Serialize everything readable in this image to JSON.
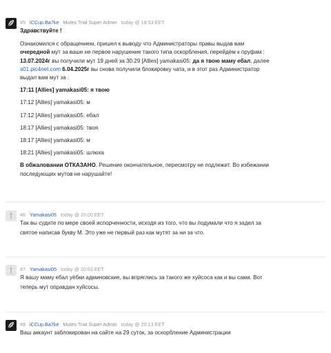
{
  "posts": [
    {
      "num": "#5",
      "user": "iCCup.Ba7ke",
      "role": "Mutes Trial Super Admin",
      "date": "today @ 18:53 EET",
      "greeting": "Здравствуйте !",
      "p1_a": "Ознакомился с обращением, пришел к выводу что Администраторы правы выдав вам ",
      "p1_b": "очередной",
      "p1_c": " мут за ваше не первое нарушение такого типа оскорбления, перейдём к пруфам :",
      "p1_d": "13.07.2024г",
      "p1_e": " вы получили мут 19 дней за 30:29 [Allies] yamakasi05: ",
      "p1_f": "да я твою маму ебал",
      "p1_g": ", далее",
      "p1_link": "s01.pic4net.com",
      "p1_h": "6.04.2025г",
      "p1_i": " вы снова получили блокировку чата, и в этот раз Администратор",
      "p1_j": "выдал вам мут за :",
      "chat": [
        "17:11 [Allies] yamakasi05: я твою",
        "17:12 [Allies] yamakasi05: м",
        "17:12 [Allies] yamakasi05: ебал",
        "18:17 [Allies] yamakasi05: твоя",
        "18:17 [Allies] yamakasi05: м",
        "18:21 [Allies] yamakasi05: шлюха"
      ],
      "decision_bold": "В обжаловании ОТКАЗАНО",
      "decision_rest": ". Решение окончательное, пересмотру не подлежит. Во избежании",
      "decision_line2": "последующих мутов не нарушайте!"
    },
    {
      "num": "#6",
      "user": "Yamakasi05",
      "date": "today @ 20:00 EET",
      "line1": "Так вы судите по мере своей испорченности, исходя из того, что вы подумали что я задел за",
      "line2": "святое написав букву М. Это уже не первый раз как мутят за ни за что."
    },
    {
      "num": "#7",
      "user": "Yamakasi05",
      "date": "today @ 20:03 EET",
      "line1": "Я вашу маму ебал уёбки админовские, вы впряглись за такого же хуйсоса как и вы сами. Вот",
      "line2": "теперь мут оправдан хуйсосы."
    },
    {
      "num": "#8",
      "user": "iCCup.Ba7ke",
      "role": "Mutes Trial Super Admin",
      "date": "today @ 20:13 EET",
      "line1": "Ваш аккаунт заблокирован на сайте на 29 суток, за оскорбление Администрации"
    }
  ]
}
